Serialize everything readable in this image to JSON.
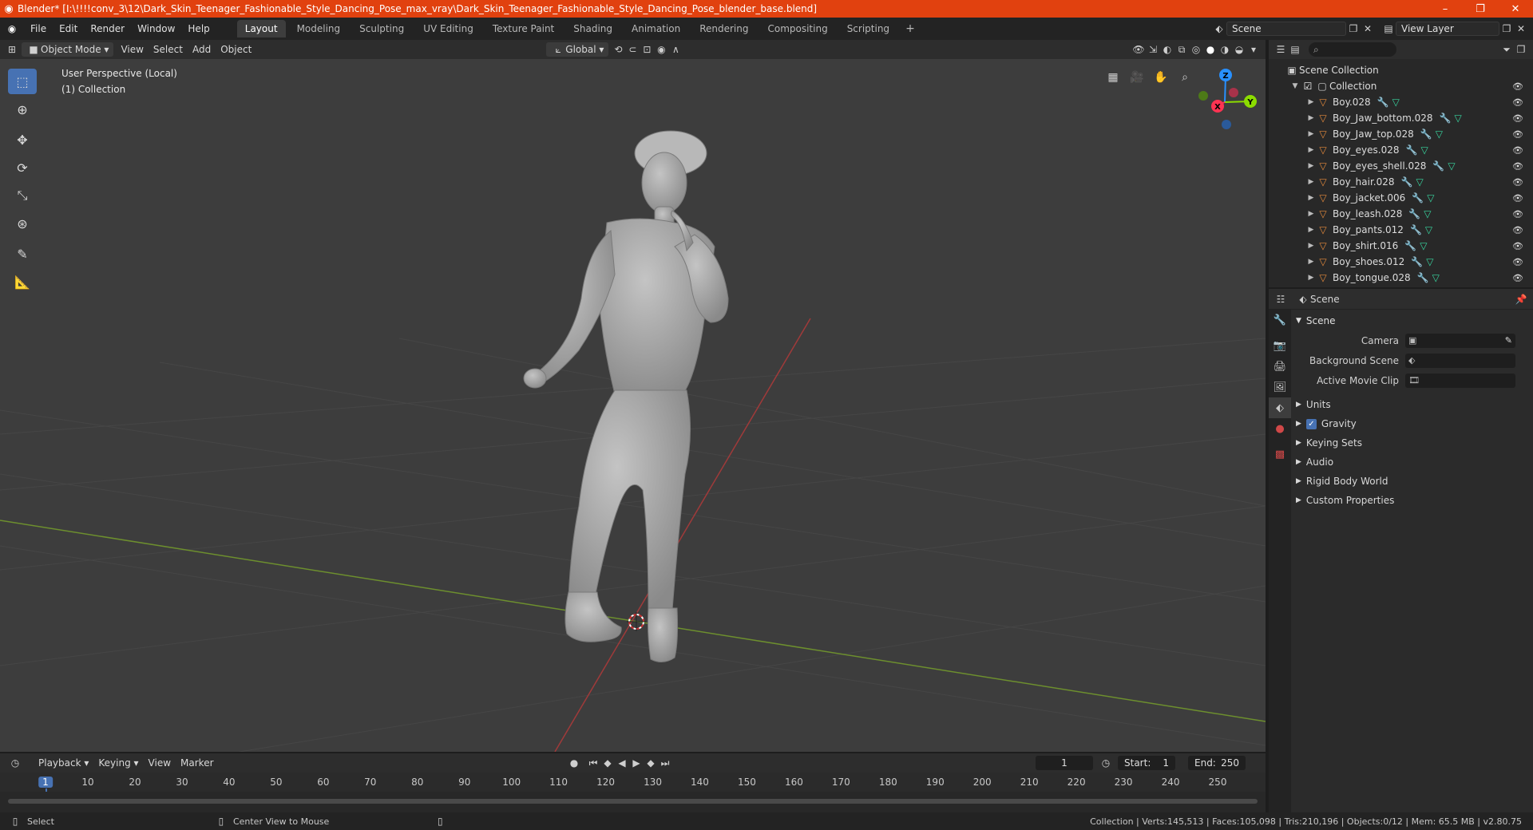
{
  "window": {
    "title": "Blender* [I:\\!!!!conv_3\\12\\Dark_Skin_Teenager_Fashionable_Style_Dancing_Pose_max_vray\\Dark_Skin_Teenager_Fashionable_Style_Dancing_Pose_blender_base.blend]",
    "minimize": "–",
    "maximize": "❐",
    "close": "✕"
  },
  "menu": {
    "items": [
      "File",
      "Edit",
      "Render",
      "Window",
      "Help"
    ],
    "workspaces": [
      "Layout",
      "Modeling",
      "Sculpting",
      "UV Editing",
      "Texture Paint",
      "Shading",
      "Animation",
      "Rendering",
      "Compositing",
      "Scripting"
    ],
    "active_workspace": "Layout",
    "add": "+",
    "scene": "Scene",
    "view_layer": "View Layer"
  },
  "viewport_header": {
    "mode": "Object Mode",
    "menus": [
      "View",
      "Select",
      "Add",
      "Object"
    ],
    "orientation": "Global"
  },
  "viewport": {
    "perspective": "User Perspective (Local)",
    "collection": "(1) Collection",
    "gizmo": {
      "x": "X",
      "y": "Y",
      "z": "Z"
    },
    "colors": {
      "x_axis": "#ff3352",
      "y_axis": "#8bdc00",
      "z_axis": "#2890ff",
      "background": "#3d3d3d",
      "grid": "#474747"
    }
  },
  "toolbar": {
    "tools": [
      "select-box",
      "cursor",
      "move",
      "rotate",
      "scale",
      "transform",
      "annotate",
      "measure"
    ]
  },
  "outliner": {
    "root": "Scene Collection",
    "collection": "Collection",
    "objects": [
      "Boy.028",
      "Boy_Jaw_bottom.028",
      "Boy_Jaw_top.028",
      "Boy_eyes.028",
      "Boy_eyes_shell.028",
      "Boy_hair.028",
      "Boy_jacket.006",
      "Boy_leash.028",
      "Boy_pants.012",
      "Boy_shirt.016",
      "Boy_shoes.012",
      "Boy_tongue.028"
    ]
  },
  "properties": {
    "header": "Scene",
    "panel": "Scene",
    "camera_label": "Camera",
    "background_scene_label": "Background Scene",
    "active_movie_clip_label": "Active Movie Clip",
    "sections": [
      "Units",
      "Gravity",
      "Keying Sets",
      "Audio",
      "Rigid Body World",
      "Custom Properties"
    ]
  },
  "timeline": {
    "menus": [
      "Playback",
      "Keying",
      "View",
      "Marker"
    ],
    "current_frame": "1",
    "start_label": "Start:",
    "start": "1",
    "end_label": "End:",
    "end": "250",
    "ticks": [
      "1",
      "10",
      "20",
      "30",
      "40",
      "50",
      "60",
      "70",
      "80",
      "90",
      "100",
      "110",
      "120",
      "130",
      "140",
      "150",
      "160",
      "170",
      "180",
      "190",
      "200",
      "210",
      "220",
      "230",
      "240",
      "250"
    ]
  },
  "statusbar": {
    "select": "Select",
    "center_view": "Center View to Mouse",
    "stats": "Collection | Verts:145,513 | Faces:105,098 | Tris:210,196 | Objects:0/12 | Mem: 65.5 MB | v2.80.75"
  }
}
